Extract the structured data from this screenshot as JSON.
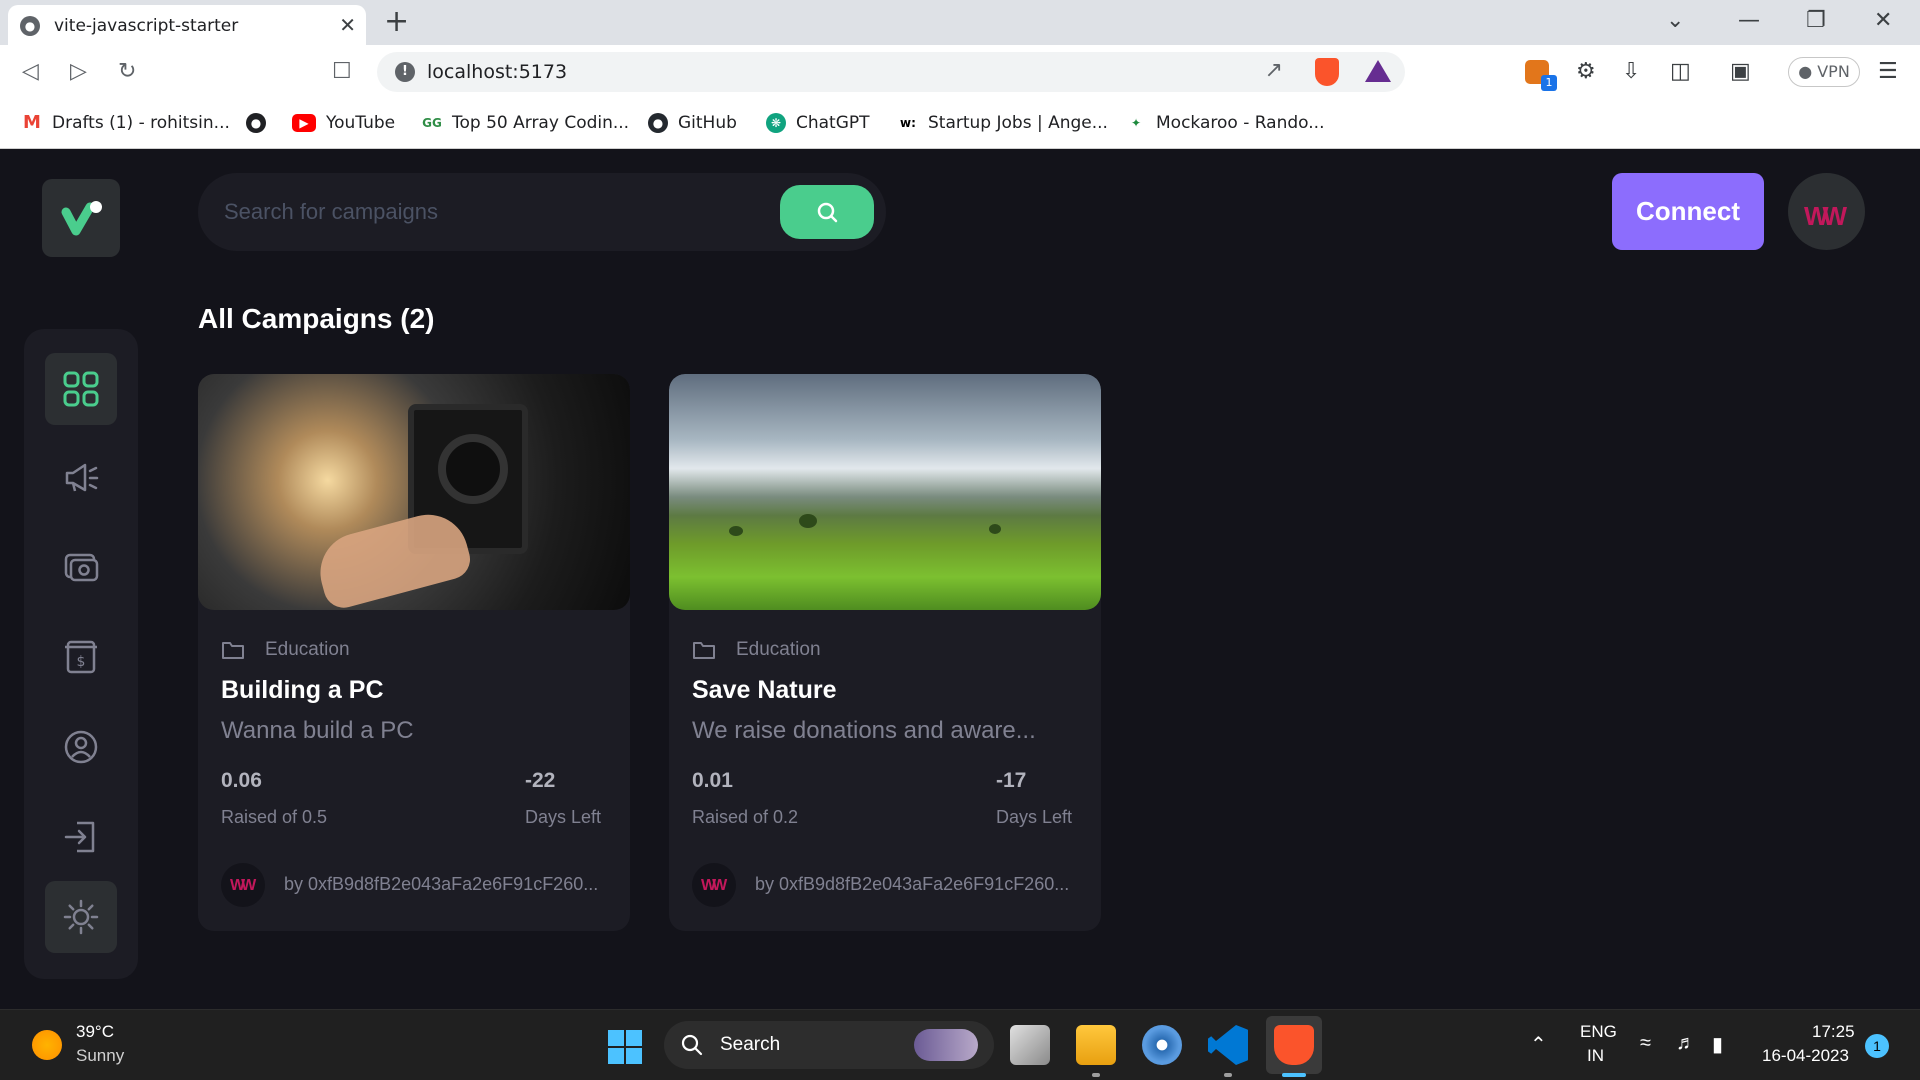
{
  "browser": {
    "tab_title": "vite-javascript-starter",
    "url": "localhost:5173",
    "vpn_label": "VPN",
    "extension_badge": "1",
    "bookmarks": [
      {
        "label": "Drafts (1) - rohitsin...",
        "icon": "gmail-icon",
        "color": "#ea4335"
      },
      {
        "label": "",
        "icon": "globe-icon",
        "color": "#202124"
      },
      {
        "label": "YouTube",
        "icon": "youtube-icon",
        "color": "#ff0000"
      },
      {
        "label": "Top 50 Array Codin...",
        "icon": "gfg-icon",
        "color": "#2f8d46"
      },
      {
        "label": "GitHub",
        "icon": "github-icon",
        "color": "#24292f"
      },
      {
        "label": "ChatGPT",
        "icon": "chatgpt-icon",
        "color": "#10a37f"
      },
      {
        "label": "Startup Jobs | Ange...",
        "icon": "wellfound-icon",
        "color": "#000000"
      },
      {
        "label": "Mockaroo - Rando...",
        "icon": "mockaroo-icon",
        "color": "#1d8a3d"
      }
    ]
  },
  "header": {
    "search_placeholder": "Search for campaigns",
    "connect_label": "Connect"
  },
  "main": {
    "title": "All Campaigns (2)",
    "campaigns": [
      {
        "category": "Education",
        "title": "Building a PC",
        "description": "Wanna build a PC",
        "raised": "0.06",
        "raised_label": "Raised of 0.5",
        "days": "-22",
        "days_label": "Days Left",
        "owner": "by 0xfB9d8fB2e043aFa2e6F91cF260..."
      },
      {
        "category": "Education",
        "title": "Save Nature",
        "description": "We raise donations and aware...",
        "raised": "0.01",
        "raised_label": "Raised of 0.2",
        "days": "-17",
        "days_label": "Days Left",
        "owner": "by 0xfB9d8fB2e043aFa2e6F91cF260..."
      }
    ]
  },
  "taskbar": {
    "temperature": "39°C",
    "weather": "Sunny",
    "search_label": "Search",
    "lang_1": "ENG",
    "lang_2": "IN",
    "time": "17:25",
    "date": "16-04-2023",
    "notifications": "1"
  },
  "colors": {
    "accent_green": "#4acd8d",
    "accent_purple": "#8c6dfd",
    "card_bg": "#1c1c24",
    "page_bg": "#13131a"
  }
}
